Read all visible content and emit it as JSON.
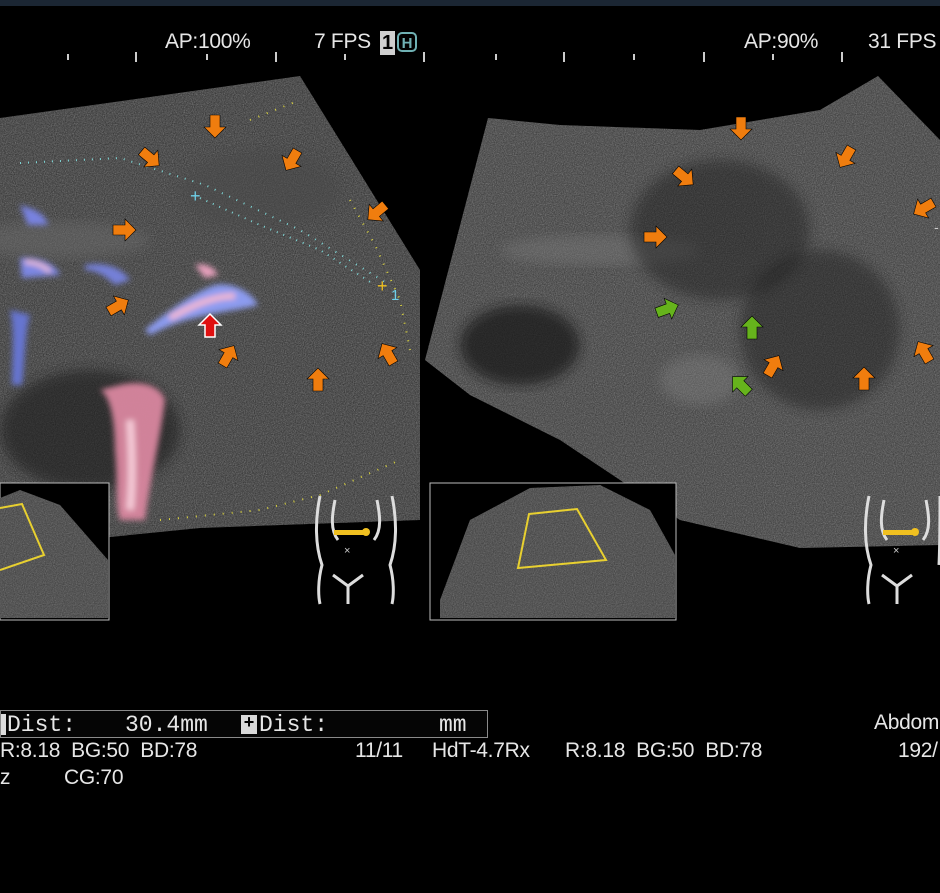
{
  "left_panel": {
    "ap": "AP:100%",
    "fps": "7 FPS",
    "frame_badge": "1",
    "harmonic_badge": "H",
    "color_scale_label": "1"
  },
  "right_panel": {
    "ap": "AP:90%",
    "fps": "31 FPS"
  },
  "measurement": {
    "dist1_label": "Dist:",
    "dist1_value": "30.4mm",
    "dist2_label": "Dist:",
    "dist2_unit": "mm"
  },
  "info_rows": {
    "left_params": "R:8.18  BG:50  BD:78",
    "frame_count": "11/11",
    "probe": "HdT-4.7Rx",
    "right_params": "R:8.18  BG:50  BD:78",
    "preset": "Abdom",
    "right_number": "192/",
    "cg_prefix": "z",
    "cg": "CG:70"
  },
  "icons": {
    "bodymark": "torso-bodymark-icon",
    "arrow_orange": "#f07d0e",
    "arrow_green": "#66b31c",
    "arrow_red": "#e01010",
    "caliper_color": "#f0c020"
  }
}
